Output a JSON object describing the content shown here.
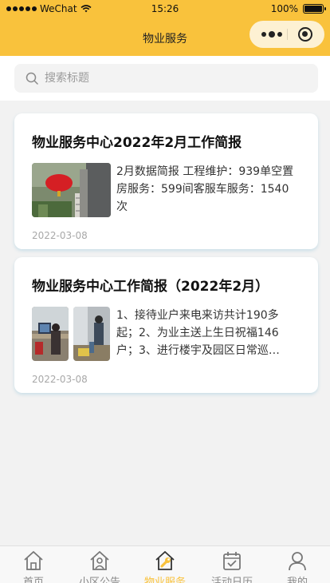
{
  "status_bar": {
    "carrier": "WeChat",
    "time": "15:26",
    "battery": "100%"
  },
  "nav": {
    "title": "物业服务"
  },
  "search": {
    "placeholder": "搜索标题"
  },
  "articles": [
    {
      "title": "物业服务中心2022年2月工作简报",
      "summary": "2月数据简报 工程维护：939单空置房服务：599间客服车服务：1540次",
      "date": "2022-03-08"
    },
    {
      "title": "物业服务中心工作简报（2022年2月）",
      "summary": "1、接待业户来电来访共计190多起；2、为业主送上生日祝福146户；3、进行楼宇及园区日常巡…",
      "date": "2022-03-08"
    }
  ],
  "tabbar": {
    "active": 2,
    "active_color": "#f9c23c",
    "items": [
      {
        "label": "首页",
        "icon": "home-icon"
      },
      {
        "label": "小区公告",
        "icon": "building-icon"
      },
      {
        "label": "物业服务",
        "icon": "wrench-icon"
      },
      {
        "label": "活动日历",
        "icon": "calendar-icon"
      },
      {
        "label": "我的",
        "icon": "user-icon"
      }
    ]
  },
  "colors": {
    "brand": "#f9c23c",
    "background": "#f2f2f2"
  }
}
